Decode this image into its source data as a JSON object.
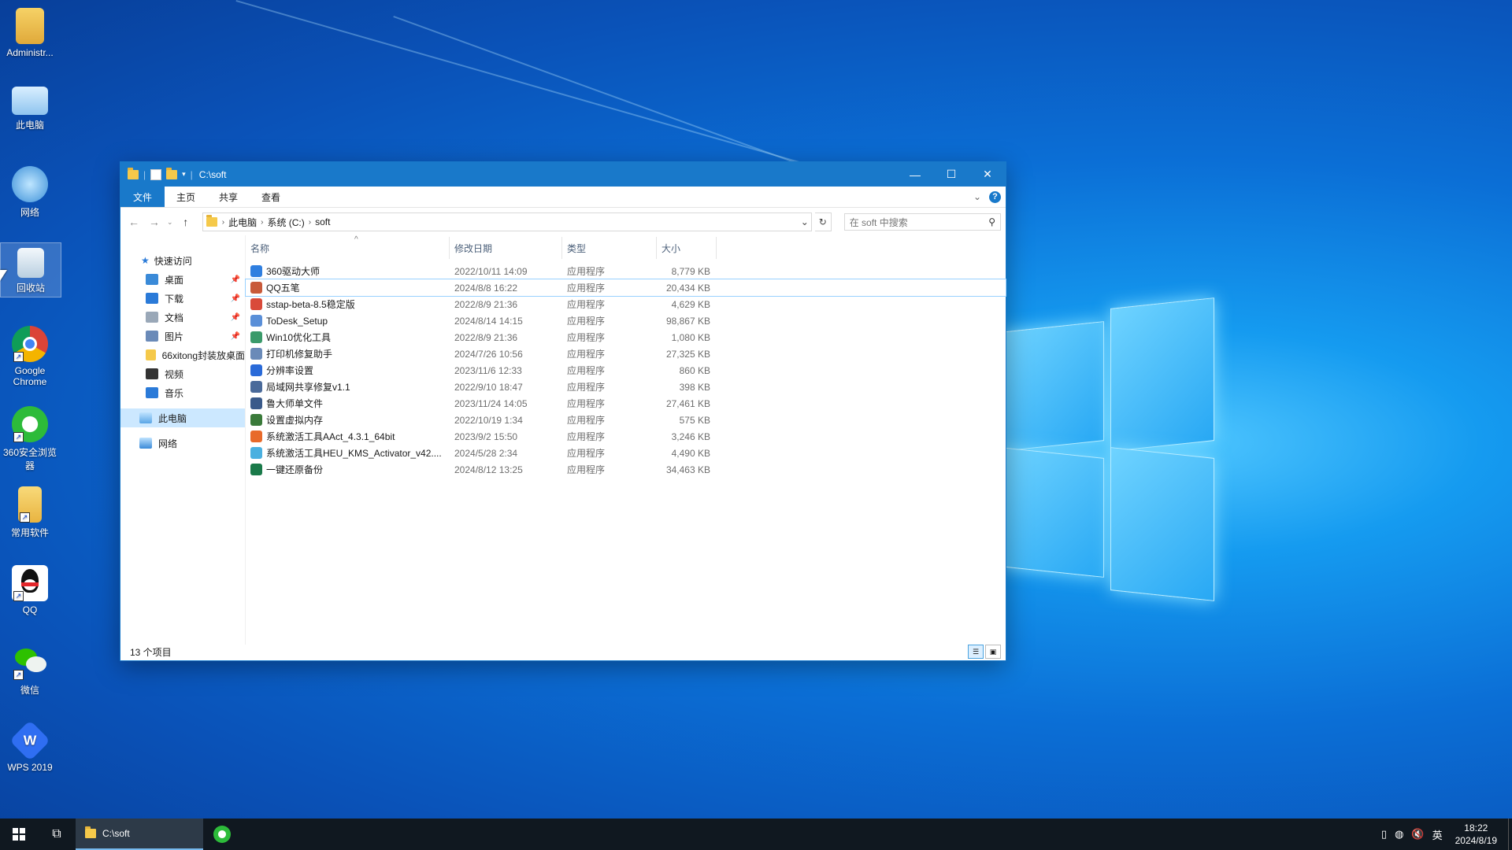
{
  "desktop": {
    "icons": [
      {
        "label": "Administr...",
        "icon": "user-folder-icon"
      },
      {
        "label": "此电脑",
        "icon": "computer-icon"
      },
      {
        "label": "网络",
        "icon": "network-icon"
      },
      {
        "label": "回收站",
        "icon": "recycle-bin-icon"
      },
      {
        "label": "Google Chrome",
        "icon": "chrome-icon"
      },
      {
        "label": "360安全浏览器",
        "icon": "360-browser-icon"
      },
      {
        "label": "常用软件",
        "icon": "folder-icon"
      },
      {
        "label": "QQ",
        "icon": "qq-icon"
      },
      {
        "label": "微信",
        "icon": "wechat-icon"
      },
      {
        "label": "WPS 2019",
        "icon": "wps-icon"
      }
    ]
  },
  "explorer": {
    "title": "C:\\soft",
    "ribbon_tabs": [
      "文件",
      "主页",
      "共享",
      "查看"
    ],
    "address": {
      "crumbs": [
        "此电脑",
        "系统 (C:)",
        "soft"
      ]
    },
    "search_placeholder": "在 soft 中搜索",
    "nav": {
      "quick_access": "快速访问",
      "items": [
        {
          "label": "桌面",
          "pinned": true
        },
        {
          "label": "下载",
          "pinned": true
        },
        {
          "label": "文档",
          "pinned": true
        },
        {
          "label": "图片",
          "pinned": true
        },
        {
          "label": "66xitong封装放桌面",
          "pinned": false
        },
        {
          "label": "视频",
          "pinned": false
        },
        {
          "label": "音乐",
          "pinned": false
        }
      ],
      "this_pc": "此电脑",
      "network": "网络"
    },
    "columns": {
      "name": "名称",
      "date": "修改日期",
      "type": "类型",
      "size": "大小"
    },
    "files": [
      {
        "name": "360驱动大师",
        "date": "2022/10/11 14:09",
        "type": "应用程序",
        "size": "8,779 KB",
        "color": "#2f7fe0"
      },
      {
        "name": "QQ五笔",
        "date": "2024/8/8 16:22",
        "type": "应用程序",
        "size": "20,434 KB",
        "color": "#c85a3a"
      },
      {
        "name": "sstap-beta-8.5稳定版",
        "date": "2022/8/9 21:36",
        "type": "应用程序",
        "size": "4,629 KB",
        "color": "#d94a3a"
      },
      {
        "name": "ToDesk_Setup",
        "date": "2024/8/14 14:15",
        "type": "应用程序",
        "size": "98,867 KB",
        "color": "#5a8fd8"
      },
      {
        "name": "Win10优化工具",
        "date": "2022/8/9 21:36",
        "type": "应用程序",
        "size": "1,080 KB",
        "color": "#3a9a6a"
      },
      {
        "name": "打印机修复助手",
        "date": "2024/7/26 10:56",
        "type": "应用程序",
        "size": "27,325 KB",
        "color": "#6a8ab8"
      },
      {
        "name": "分辨率设置",
        "date": "2023/11/6 12:33",
        "type": "应用程序",
        "size": "860 KB",
        "color": "#2a6ad8"
      },
      {
        "name": "局域网共享修复v1.1",
        "date": "2022/9/10 18:47",
        "type": "应用程序",
        "size": "398 KB",
        "color": "#4a6a9a"
      },
      {
        "name": "鲁大师单文件",
        "date": "2023/11/24 14:05",
        "type": "应用程序",
        "size": "27,461 KB",
        "color": "#3a5a8a"
      },
      {
        "name": "设置虚拟内存",
        "date": "2022/10/19 1:34",
        "type": "应用程序",
        "size": "575 KB",
        "color": "#3a7a3a"
      },
      {
        "name": "系统激活工具AAct_4.3.1_64bit",
        "date": "2023/9/2 15:50",
        "type": "应用程序",
        "size": "3,246 KB",
        "color": "#e86a2a"
      },
      {
        "name": "系统激活工具HEU_KMS_Activator_v42....",
        "date": "2024/5/28 2:34",
        "type": "应用程序",
        "size": "4,490 KB",
        "color": "#4ab0e0"
      },
      {
        "name": "一键还原备份",
        "date": "2024/8/12 13:25",
        "type": "应用程序",
        "size": "34,463 KB",
        "color": "#1a7a4a"
      }
    ],
    "status": "13 个项目"
  },
  "taskbar": {
    "app_label": "C:\\soft",
    "ime": "英",
    "time": "18:22",
    "date": "2024/8/19"
  }
}
